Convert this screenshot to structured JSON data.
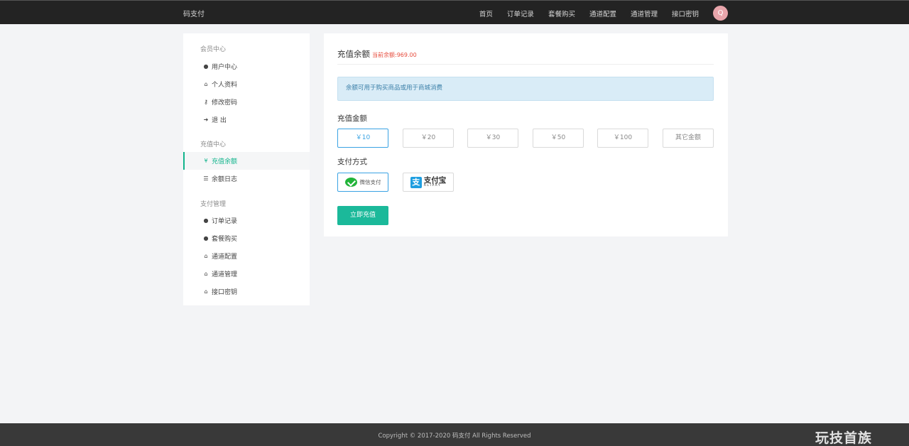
{
  "header": {
    "brand": "码支付",
    "nav": [
      "首页",
      "订单记录",
      "套餐购买",
      "通道配置",
      "通道管理",
      "接口密钥"
    ],
    "avatar_letter": "Q"
  },
  "sidebar": {
    "groups": [
      {
        "title": "会员中心",
        "items": [
          {
            "label": "用户中心",
            "icon": "user-circle-icon"
          },
          {
            "label": "个人资料",
            "icon": "lock-icon"
          },
          {
            "label": "修改密码",
            "icon": "key-icon"
          },
          {
            "label": "退 出",
            "icon": "sign-out-icon"
          }
        ]
      },
      {
        "title": "充值中心",
        "items": [
          {
            "label": "充值余额",
            "icon": "yen-icon",
            "active": true
          },
          {
            "label": "余额日志",
            "icon": "list-icon"
          }
        ]
      },
      {
        "title": "支付管理",
        "items": [
          {
            "label": "订单记录",
            "icon": "user-circle-icon"
          },
          {
            "label": "套餐购买",
            "icon": "user-circle-icon"
          },
          {
            "label": "通道配置",
            "icon": "lock-icon"
          },
          {
            "label": "通道管理",
            "icon": "lock-icon"
          },
          {
            "label": "接口密钥",
            "icon": "lock-icon"
          }
        ]
      }
    ]
  },
  "main": {
    "title": "充值余额",
    "balance_note": "当前余额:969.00",
    "alert": "余额可用于购买商品或用于商城消费",
    "amount_label": "充值金额",
    "amounts": [
      "￥10",
      "￥20",
      "￥30",
      "￥50",
      "￥100",
      "其它金额"
    ],
    "selected_amount_index": 0,
    "pay_label": "支付方式",
    "pay_methods": {
      "wechat": "微信支付",
      "alipay_cn": "支付宝",
      "alipay_en": "ALIPAY"
    },
    "submit": "立即充值"
  },
  "footer": {
    "copyright": "Copyright © 2017-2020 码支付 All Rights Reserved",
    "watermark": "玩技首族"
  },
  "colors": {
    "accent": "#12b48c",
    "primary_button": "#1bb99a",
    "selected_border": "#3aa3e3",
    "balance_text": "#e64a3b"
  }
}
